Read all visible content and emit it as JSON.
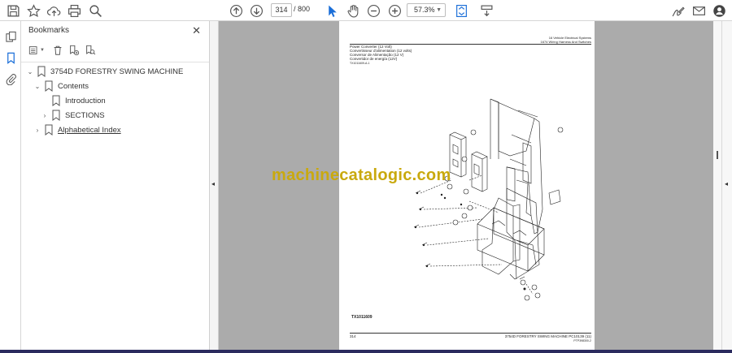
{
  "toolbar": {
    "current_page": "314",
    "page_separator": "/ 800",
    "zoom": "57.3%"
  },
  "panel": {
    "title": "Bookmarks",
    "items": [
      {
        "label": "3754D FORESTRY SWING MACHINE"
      },
      {
        "label": "Contents"
      },
      {
        "label": "Introduction"
      },
      {
        "label": "SECTIONS"
      },
      {
        "label": "Alphabetical Index"
      }
    ]
  },
  "document": {
    "header_right_1": "16 Vehicle Electrical Systems",
    "header_right_2": "1674 Wiring Harness And Switches",
    "header_left_1": "Power Converter (12 Volt)",
    "header_left_2": "Convertisseur d'alimentation (12 volts)",
    "header_left_3": "Conversor de Alimentação (12 V)",
    "header_left_4": "Convertidor de energía (12V)",
    "header_left_5": "TX1011609-A-1",
    "figure_id": "TX1011609",
    "footer_page": "314",
    "footer_right": "3754D FORESTRY SWING MACHINE   PC10139   (11)",
    "footer_right_small": "PTP398300-2",
    "watermark": "machinecatalogic.com"
  }
}
